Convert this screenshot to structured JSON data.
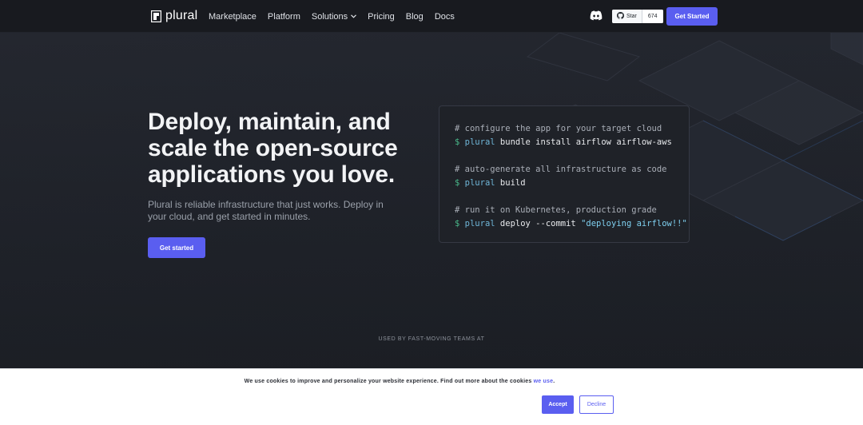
{
  "nav": {
    "logo_text": "plural",
    "links": [
      {
        "label": "Marketplace"
      },
      {
        "label": "Platform"
      },
      {
        "label": "Solutions",
        "dropdown": true
      },
      {
        "label": "Pricing"
      },
      {
        "label": "Blog"
      },
      {
        "label": "Docs"
      }
    ],
    "github": {
      "star_label": "Star",
      "count": "674"
    },
    "cta_label": "Get Started",
    "icons": {
      "discord": "discord-icon",
      "github": "github-icon",
      "dropdown": "chevron-down-icon"
    }
  },
  "hero": {
    "title": "Deploy, maintain, and scale the open-source applications you love.",
    "subtitle": "Plural is reliable infrastructure that just works. Deploy in your cloud, and get started in minutes.",
    "cta_label": "Get started"
  },
  "code": {
    "blocks": [
      {
        "comment": "# configure the app for your target cloud",
        "prompt": "$",
        "cmd": "plural",
        "args": "bundle install airflow airflow-aws",
        "str": ""
      },
      {
        "comment": "# auto-generate all infrastructure as code",
        "prompt": "$",
        "cmd": "plural",
        "args": "build",
        "str": ""
      },
      {
        "comment": "# run it on Kubernetes, production grade",
        "prompt": "$",
        "cmd": "plural",
        "args": "deploy --commit",
        "str": "\"deploying airflow!!\""
      }
    ]
  },
  "used_by": "USED BY FAST-MOVING TEAMS AT",
  "cookie": {
    "text": "We use cookies to improve and personalize your website experience. Find out more about the cookies",
    "link_text": "we use",
    "after_link": ".",
    "accept_label": "Accept",
    "decline_label": "Decline"
  },
  "colors": {
    "accent": "#5a5ef0",
    "background": "#1c1f26",
    "nav_background": "#181a1f",
    "code_prompt": "#49b98a",
    "code_command": "#6fb6d8"
  }
}
